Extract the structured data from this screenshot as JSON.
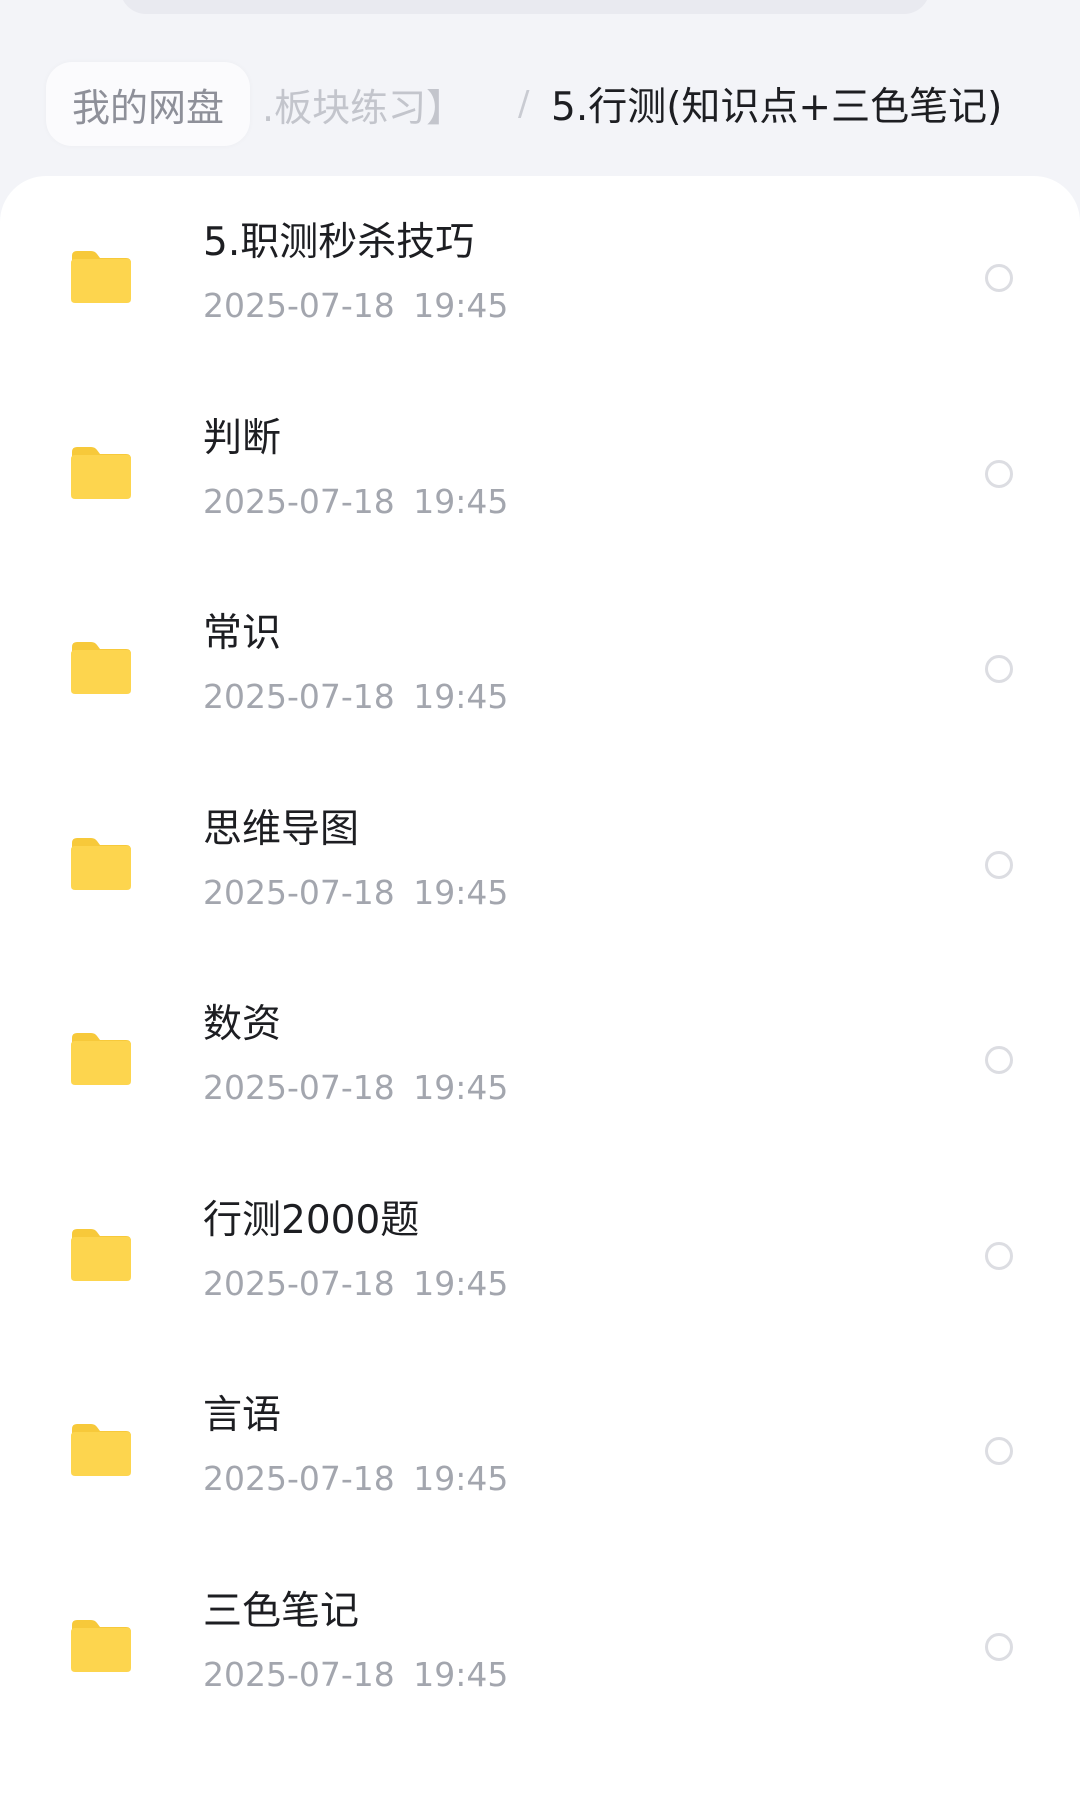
{
  "breadcrumb": {
    "root": "我的网盘",
    "middle": ".板块练习】",
    "separator": "/",
    "current": "5.行测(知识点+三色笔记)"
  },
  "colors": {
    "folder": "#fdd54e",
    "folder_tab": "#f7c93a",
    "page_background": "#f3f4f8",
    "panel_background": "#ffffff"
  },
  "files": [
    {
      "name": "5.职测秒杀技巧",
      "date": "2025-07-18  19:45",
      "icon": "folder-icon"
    },
    {
      "name": "判断",
      "date": "2025-07-18  19:45",
      "icon": "folder-icon"
    },
    {
      "name": "常识",
      "date": "2025-07-18  19:45",
      "icon": "folder-icon"
    },
    {
      "name": "思维导图",
      "date": "2025-07-18  19:45",
      "icon": "folder-icon"
    },
    {
      "name": "数资",
      "date": "2025-07-18  19:45",
      "icon": "folder-icon"
    },
    {
      "name": "行测2000题",
      "date": "2025-07-18  19:45",
      "icon": "folder-icon"
    },
    {
      "name": "言语",
      "date": "2025-07-18  19:45",
      "icon": "folder-icon"
    },
    {
      "name": "三色笔记",
      "date": "2025-07-18  19:45",
      "icon": "folder-icon"
    }
  ]
}
